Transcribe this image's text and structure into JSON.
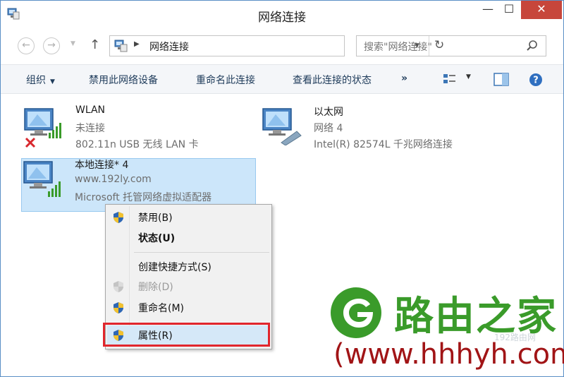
{
  "window": {
    "title": "网络连接",
    "controls": {
      "minimize": "—",
      "maximize": "☐",
      "close": "✕"
    }
  },
  "nav": {
    "back": "←",
    "forward": "→",
    "up": "↑",
    "address": "网络连接",
    "refresh": "↻",
    "search_placeholder": "搜索\"网络连接\""
  },
  "toolbar": {
    "organize": "组织",
    "disable_device": "禁用此网络设备",
    "rename": "重命名此连接",
    "view_status": "查看此连接的状态",
    "more": "»"
  },
  "connections": [
    {
      "name": "WLAN",
      "status": "未连接",
      "device": "802.11n USB 无线 LAN 卡"
    },
    {
      "name": "以太网",
      "status": "网络  4",
      "device": "Intel(R) 82574L 千兆网络连接"
    },
    {
      "name": "本地连接* 4",
      "status": "www.192ly.com",
      "device": "Microsoft 托管网络虚拟适配器"
    }
  ],
  "context_menu": {
    "items": [
      {
        "label": "禁用(B)"
      },
      {
        "label": "状态(U)"
      },
      {
        "label": "创建快捷方式(S)"
      },
      {
        "label": "删除(D)"
      },
      {
        "label": "重命名(M)"
      },
      {
        "label": "属性(R)"
      }
    ]
  },
  "watermark": {
    "title": "路由之家",
    "url": "(www.hhhyh.com)",
    "faint": "192路由网"
  },
  "colors": {
    "accent": "#1e3b5a",
    "selection": "#cce6fa",
    "highlight_box": "#e1262d",
    "watermark_green": "#3a9b2a",
    "watermark_red": "#a11416",
    "close_button": "#c7463b"
  }
}
